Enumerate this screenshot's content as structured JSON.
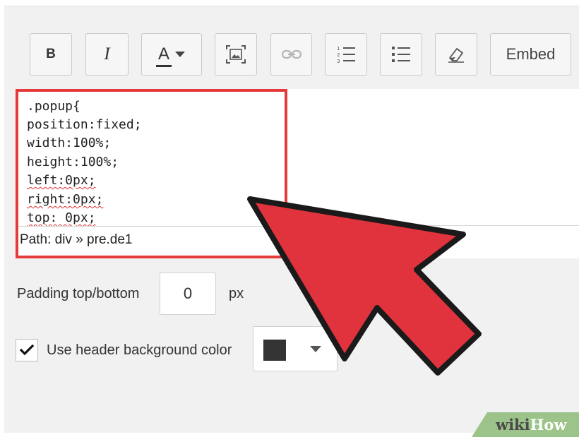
{
  "toolbar": {
    "bold_label": "B",
    "italic_label": "I",
    "text_color_label": "A",
    "embed_label": "Embed",
    "icons": [
      "bold-icon",
      "italic-icon",
      "text-color-icon",
      "chevron-down-icon",
      "image-icon",
      "link-icon",
      "ordered-list-icon",
      "bullet-list-icon",
      "eraser-icon"
    ]
  },
  "editor": {
    "code_lines": [
      ".popup{",
      "position:fixed;",
      "width:100%;",
      "height:100%;",
      "left:0px;",
      "right:0px;",
      "top: 0px;"
    ],
    "path": "Path: div » pre.de1",
    "highlight_color": "#e43a3a"
  },
  "settings": {
    "padding_label": "Padding top/bottom",
    "padding_value": "0",
    "padding_unit": "px",
    "header_bg_label": "Use header background color",
    "header_bg_checked": true,
    "swatch_color": "#333333"
  },
  "annotation": {
    "arrow_color": "#e0333d",
    "arrow_icon": "pointer-arrow-icon"
  },
  "watermark": {
    "wiki": "wiki",
    "how": "How"
  }
}
